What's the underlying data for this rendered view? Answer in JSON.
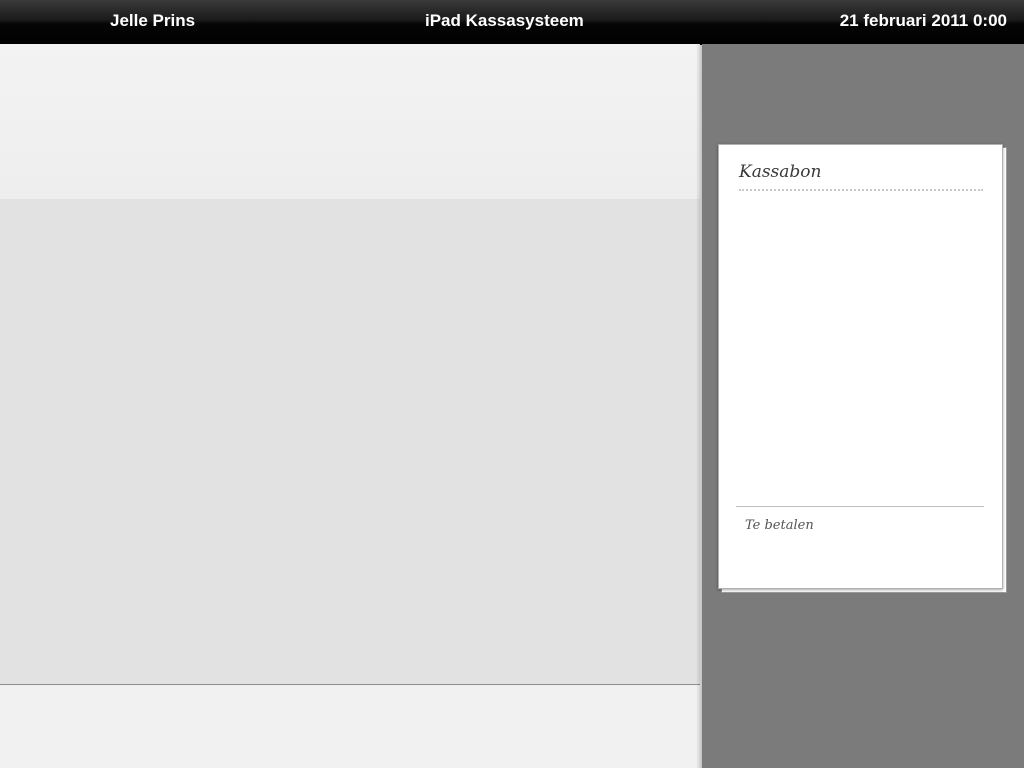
{
  "statusbar": {
    "user": "Jelle Prins",
    "title": "iPad Kassasysteem",
    "datetime": "21 februari 2011 0:00"
  },
  "receipt": {
    "title": "Kassabon",
    "items": [],
    "total_label": "Te betalen"
  }
}
